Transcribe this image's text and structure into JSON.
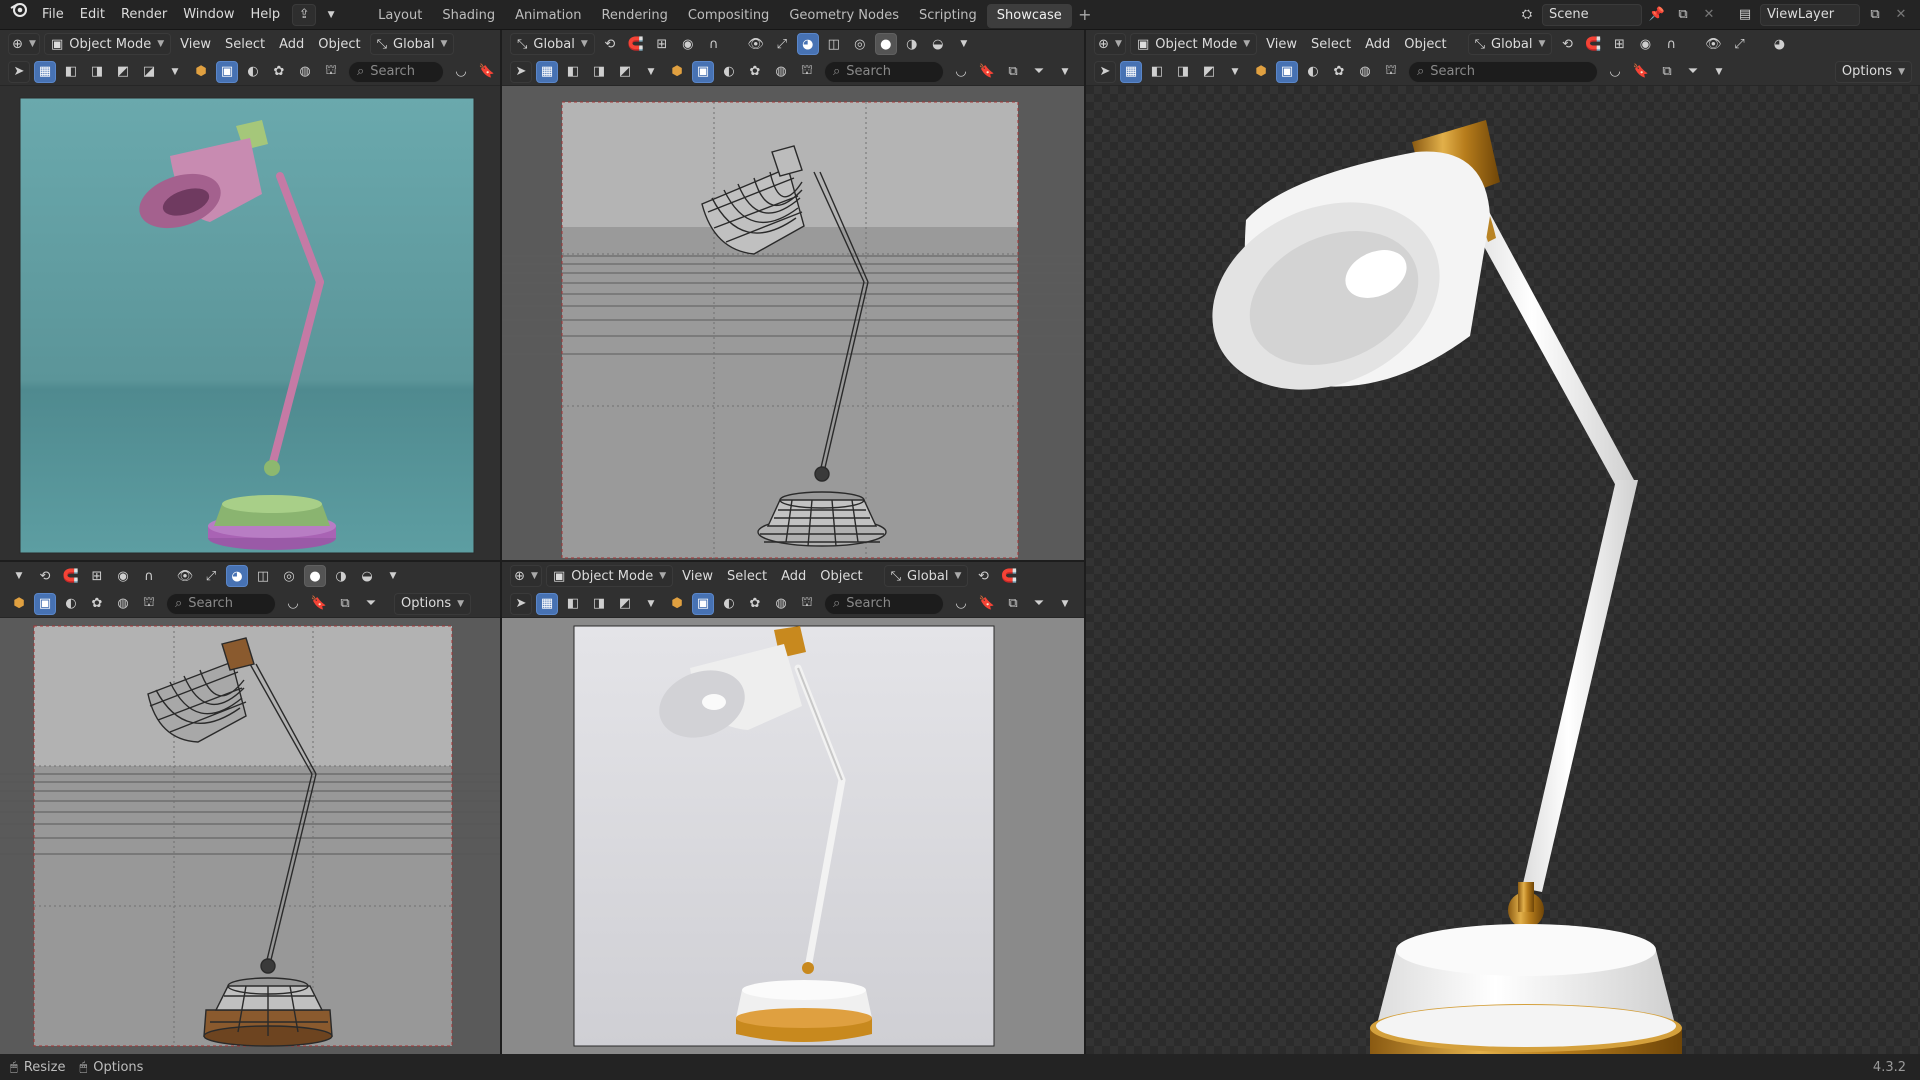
{
  "app": {
    "version": "4.3.2"
  },
  "menu": [
    "File",
    "Edit",
    "Render",
    "Window",
    "Help"
  ],
  "workspaces": [
    "Layout",
    "Shading",
    "Animation",
    "Rendering",
    "Compositing",
    "Geometry Nodes",
    "Scripting",
    "Showcase"
  ],
  "active_workspace": "Showcase",
  "scene": {
    "label": "Scene"
  },
  "view_layer": {
    "label": "ViewLayer"
  },
  "viewport": {
    "mode": "Object Mode",
    "menus": [
      "View",
      "Select",
      "Add",
      "Object"
    ],
    "orientation": "Global",
    "search_placeholder": "Search",
    "options_label": "Options"
  },
  "status": {
    "resize": "Resize",
    "options": "Options"
  },
  "colors": {
    "accent": "#4772b3",
    "gold": "#c8891e",
    "viewport_teal": "#5f9ea3"
  }
}
